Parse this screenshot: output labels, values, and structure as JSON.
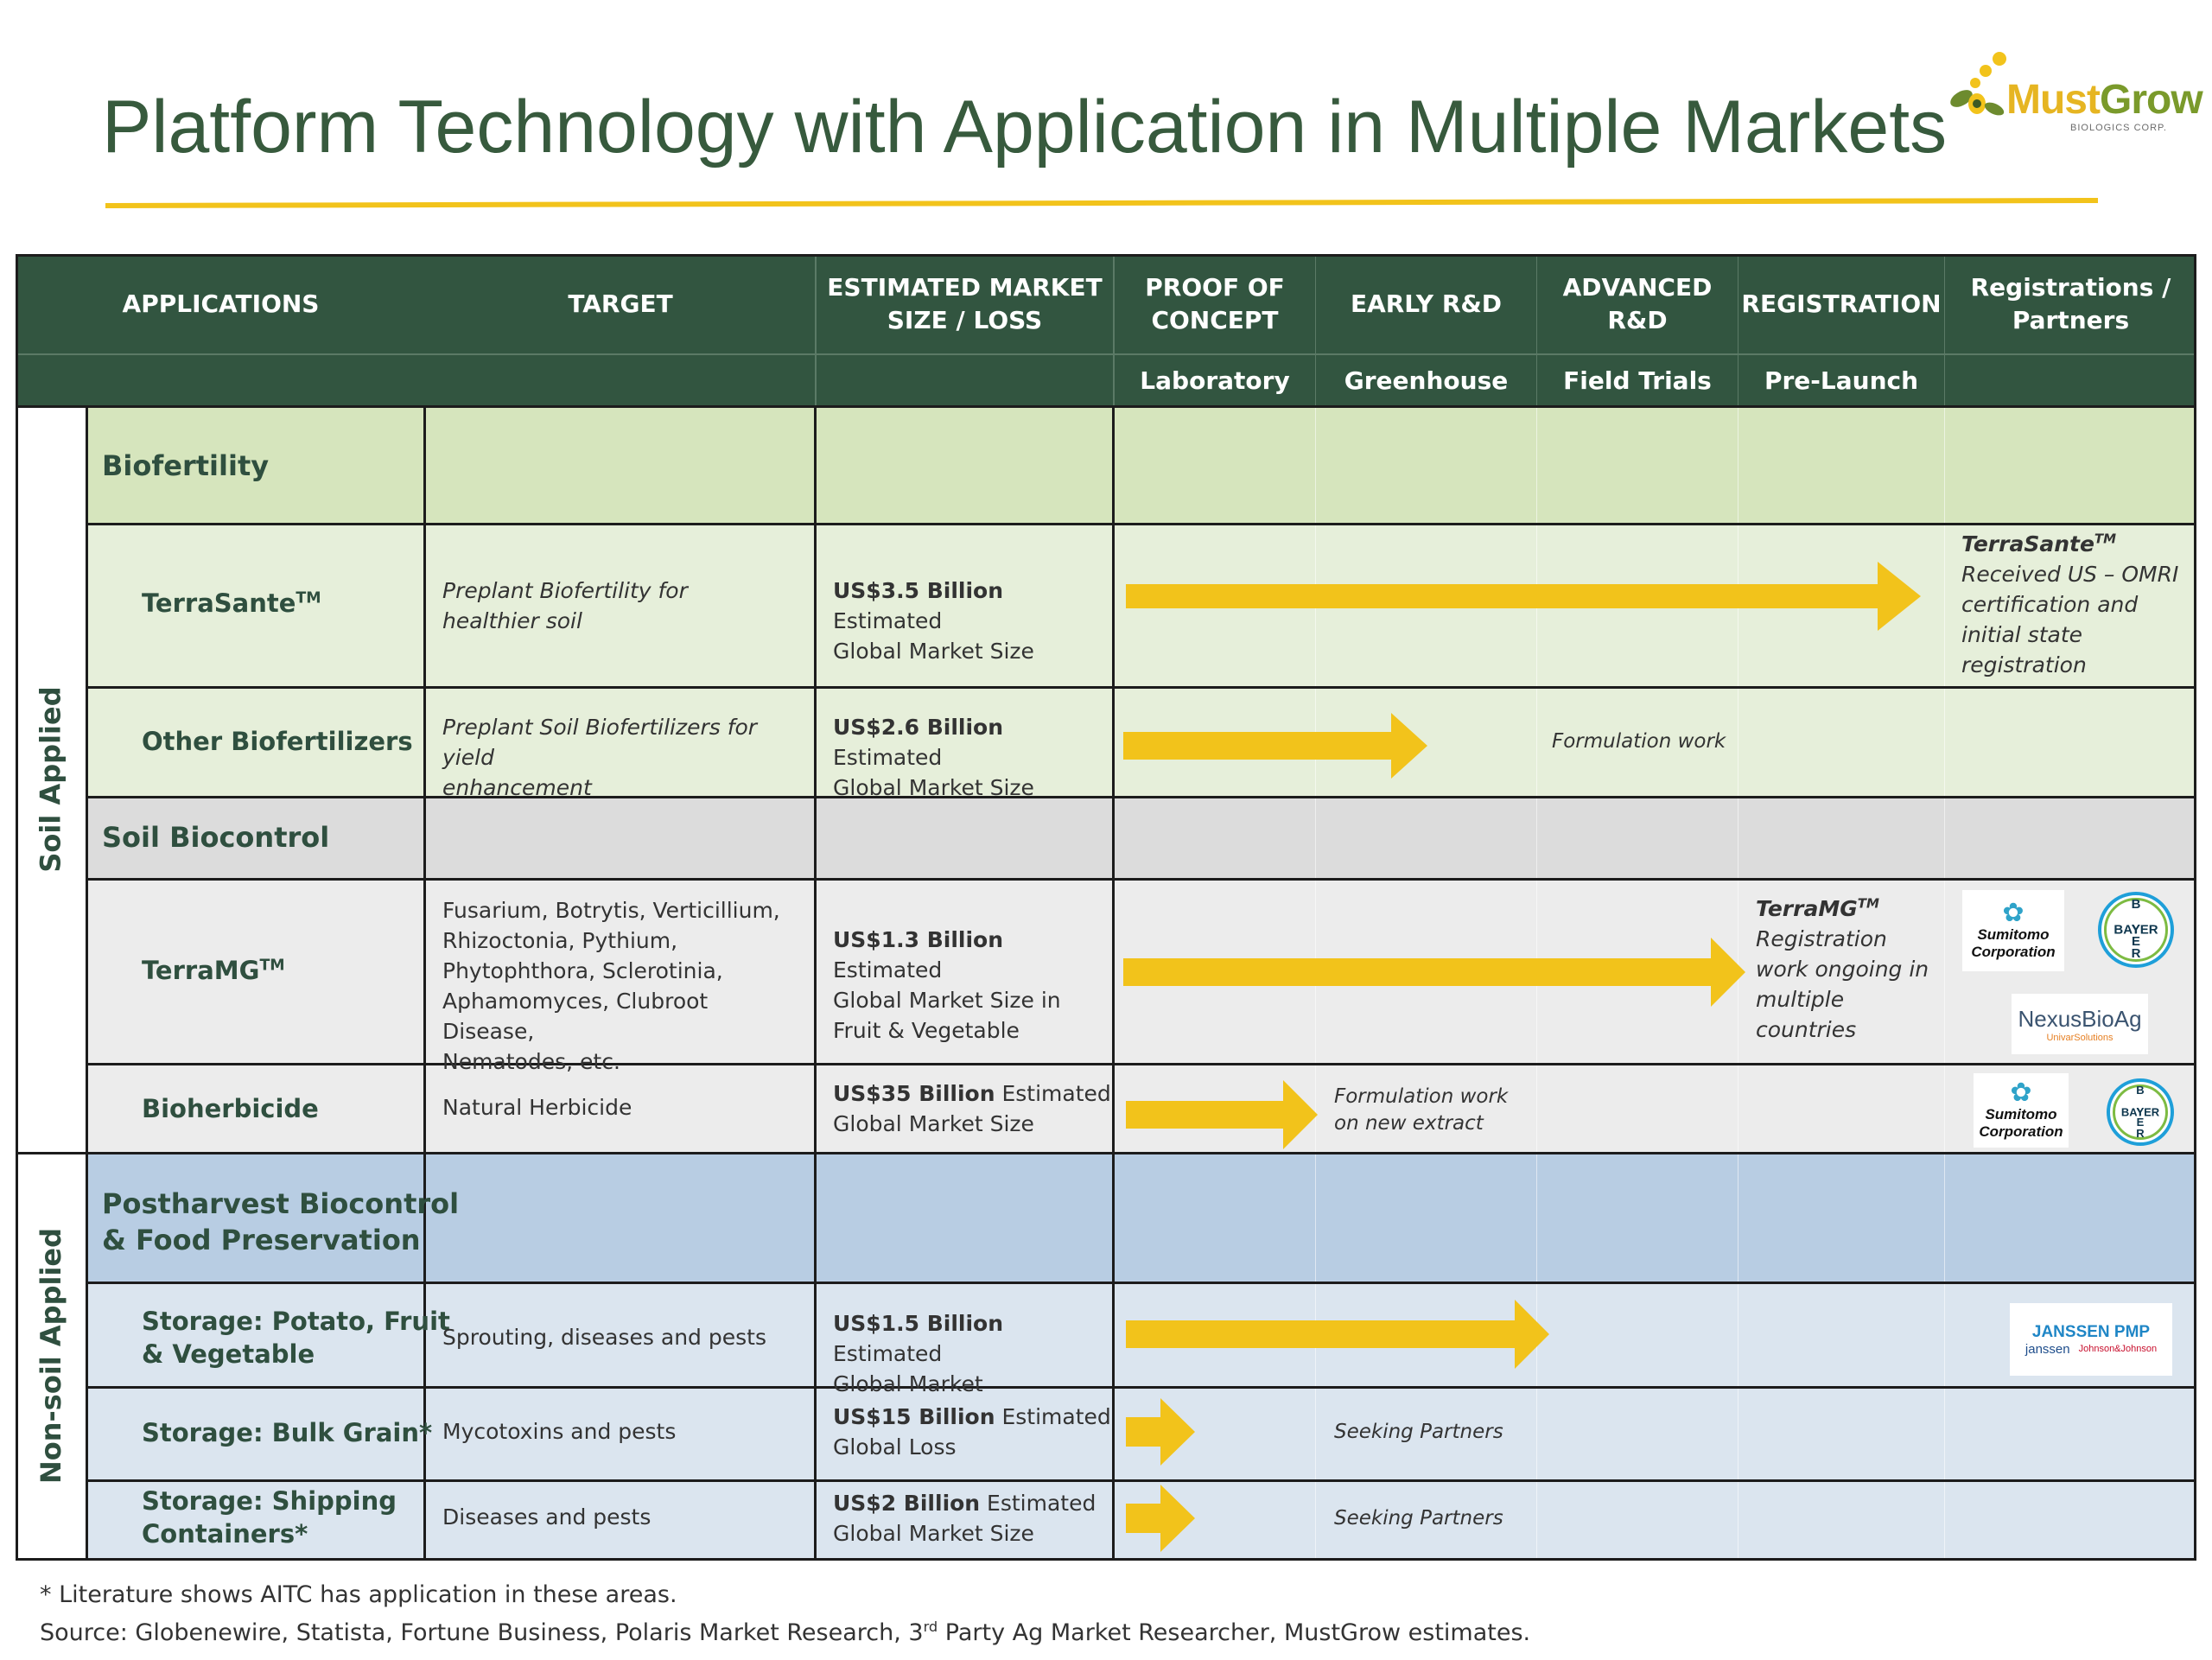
{
  "title": "Platform Technology with Application in Multiple Markets",
  "logo": {
    "name_part1": "Must",
    "name_part2": "Grow",
    "subtitle": "BIOLOGICS CORP."
  },
  "colors": {
    "header_bg": "#325540",
    "accent_yellow": "#f2c31b",
    "title_green": "#375a3d",
    "biofertility_band": "#d6e5bd",
    "biofertility_rows": "#e6efda",
    "biocontrol_band": "#dcdcdc",
    "biocontrol_rows": "#ececec",
    "postharvest_band": "#b8cde3",
    "postharvest_rows": "#dbe5ef"
  },
  "header": {
    "applications": "APPLICATIONS",
    "target": "TARGET",
    "market_line1": "ESTIMATED MARKET",
    "market_line2": "SIZE / LOSS",
    "poc_line1": "PROOF OF",
    "poc_line2": "CONCEPT",
    "early_rd": "EARLY R&D",
    "adv_line1": "ADVANCED",
    "adv_line2": "R&D",
    "registration": "REGISTRATION",
    "partners_line1": "Registrations /",
    "partners_line2": "Partners",
    "sub_lab": "Laboratory",
    "sub_greenhouse": "Greenhouse",
    "sub_field": "Field Trials",
    "sub_prelaunch": "Pre-Launch"
  },
  "groups": {
    "soil": "Soil Applied",
    "nonsoil": "Non-soil Applied"
  },
  "sections": {
    "biofertility": "Biofertility",
    "soil_biocontrol": "Soil Biocontrol",
    "postharvest_line1": "Postharvest Biocontrol",
    "postharvest_line2": "& Food Preservation"
  },
  "tm": "TM",
  "rows": {
    "terrasante": {
      "app": "TerraSante",
      "target_line1": "Preplant Biofertility for",
      "target_line2": "healthier soil",
      "market_bold": "US$3.5 Billion",
      "market_rest1": " Estimated",
      "market_line2": "Global Market Size",
      "reg_name": "TerraSante",
      "reg_line1": "Received US – OMRI",
      "reg_line2": "certification and",
      "reg_line3": "initial state",
      "reg_line4": "registration",
      "progress_stage": "Pre-Launch"
    },
    "other_biofert": {
      "app": "Other Biofertilizers",
      "target_line1": "Preplant Soil Biofertilizers for yield",
      "target_line2": "enhancement",
      "market_bold": "US$2.6 Billion",
      "market_rest1": " Estimated",
      "market_line2": "Global Market Size",
      "note": "Formulation work",
      "progress_stage": "Greenhouse"
    },
    "terramg": {
      "app": "TerraMG",
      "target_lines": [
        "Fusarium, Botrytis, Verticillium,",
        "Rhizoctonia, Pythium,",
        "Phytophthora, Sclerotinia,",
        "Aphamomyces, Clubroot Disease,",
        "Nematodes, etc."
      ],
      "market_bold": "US$1.3 Billion",
      "market_rest1": " Estimated",
      "market_line2": "Global Market Size in",
      "market_line3": "Fruit & Vegetable",
      "reg_name": "TerraMG",
      "reg_line1": "Registration",
      "reg_line2": "work ongoing in",
      "reg_line3": "multiple",
      "reg_line4": "countries",
      "progress_stage": "Registration"
    },
    "bioherbicide": {
      "app": "Bioherbicide",
      "target": "Natural Herbicide",
      "market_bold": "US$35 Billion",
      "market_rest1": " Estimated",
      "market_line2": "Global Market Size",
      "note_line1": "Formulation work",
      "note_line2": "on new extract",
      "progress_stage": "Laboratory"
    },
    "storage_potato": {
      "app_line1": "Storage: Potato, Fruit",
      "app_line2": "& Vegetable",
      "target": "Sprouting, diseases and pests",
      "market_bold": "US$1.5 Billion",
      "market_rest1": " Estimated",
      "market_line2": "Global Market",
      "progress_stage": "Field Trials"
    },
    "storage_grain": {
      "app": "Storage: Bulk Grain*",
      "target": "Mycotoxins and pests",
      "market_bold": "US$15 Billion",
      "market_rest1": " Estimated",
      "market_line2": "Global Loss",
      "note": "Seeking Partners",
      "progress_stage": "Laboratory"
    },
    "storage_shipping": {
      "app_line1": "Storage: Shipping",
      "app_line2": "Containers*",
      "target": "Diseases and pests",
      "market_bold": "US$2 Billion",
      "market_rest1": " Estimated",
      "market_line2": "Global Market Size",
      "note": "Seeking Partners",
      "progress_stage": "Laboratory"
    }
  },
  "partners": {
    "sumitomo_line1": "Sumitomo",
    "sumitomo_line2": "Corporation",
    "bayer": "BAYER",
    "nexus": "NexusBioAg",
    "nexus_sub": "UnivarSolutions",
    "janssen_pmp": "JANSSEN PMP",
    "janssen": "janssen",
    "jnj": "Johnson&Johnson"
  },
  "footnote": "* Literature shows AITC has application in these areas.",
  "source_prefix": "Source: Globenewire, Statista, Fortune Business, Polaris Market Research, 3",
  "source_sup": "rd",
  "source_suffix": " Party Ag Market Researcher, MustGrow estimates."
}
